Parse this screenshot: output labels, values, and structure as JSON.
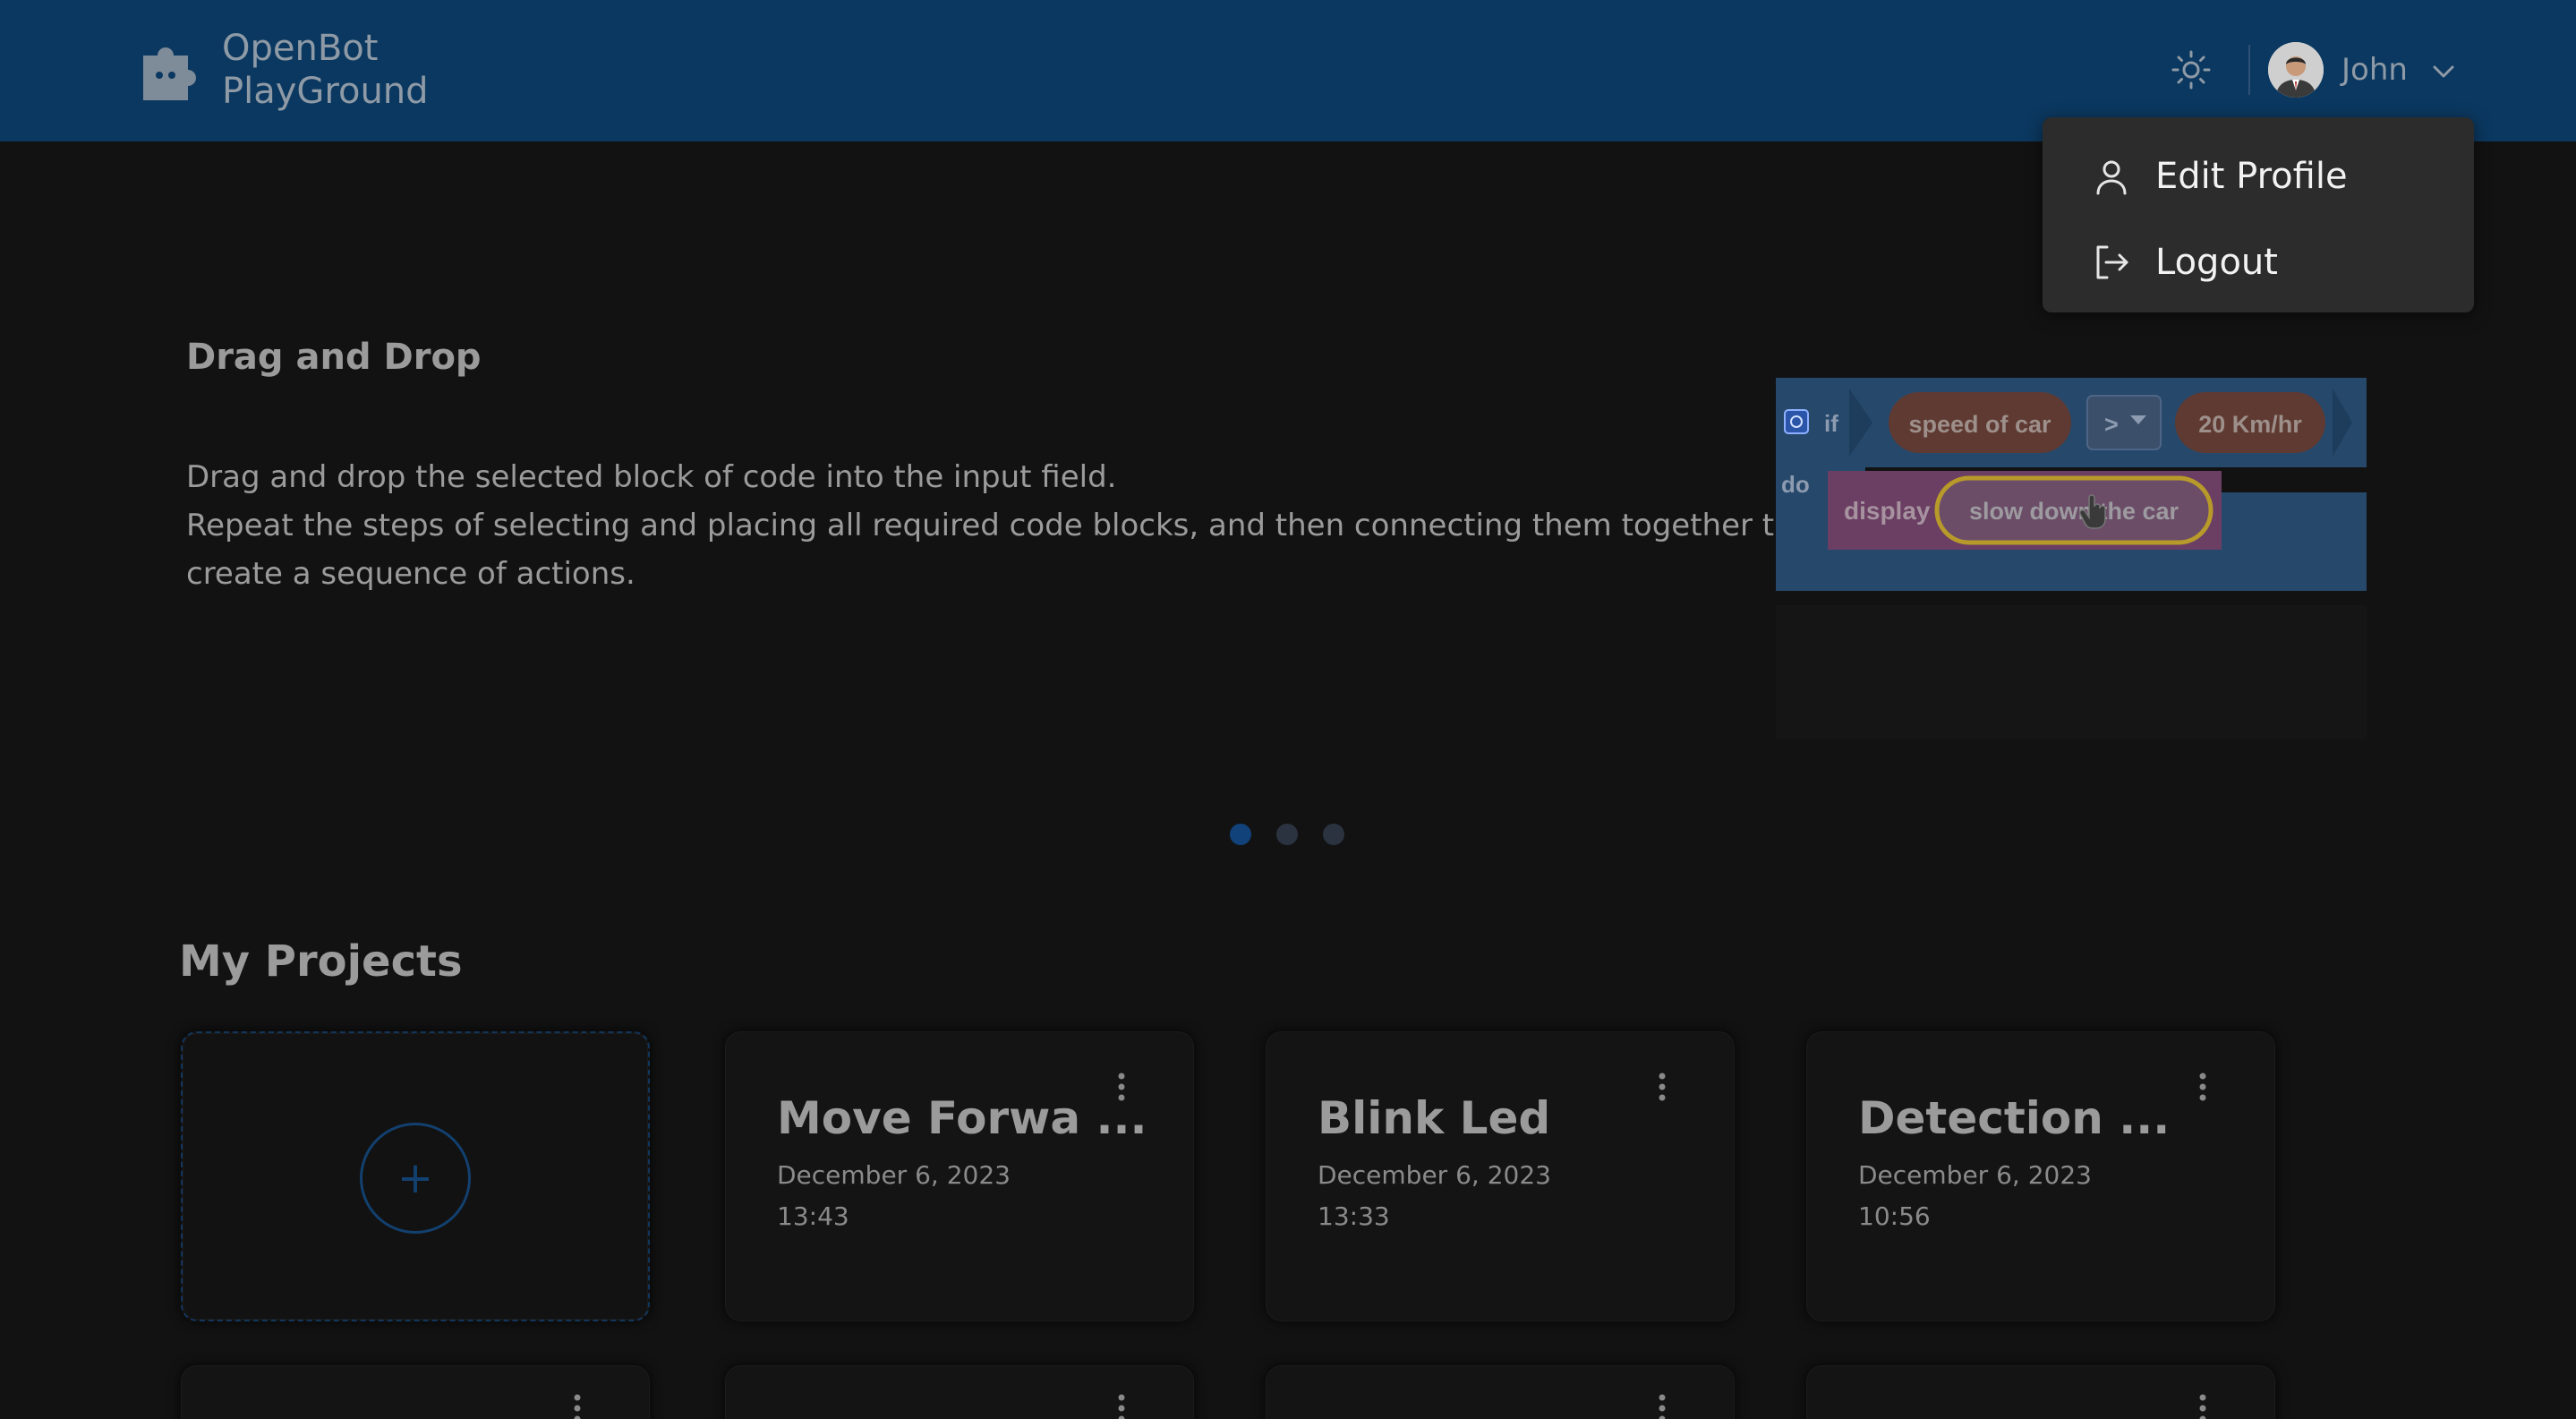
{
  "header": {
    "brand_line1": "OpenBot",
    "brand_line2": "PlayGround",
    "user_name": "John",
    "bg_color": "#0b3860"
  },
  "user_menu": {
    "items": [
      {
        "label": "Edit Profile",
        "icon": "user-icon"
      },
      {
        "label": "Logout",
        "icon": "logout-icon"
      }
    ]
  },
  "carousel": {
    "title": "Drag and Drop",
    "description_lines": [
      "Drag and drop the selected block of code into the input field.",
      "Repeat the steps of selecting and placing all required code blocks, and then connecting them together to",
      "create a sequence of actions."
    ],
    "block": {
      "if_label": "if",
      "do_label": "do",
      "condition_left": "speed of car",
      "operator": ">",
      "condition_right": "20 Km/hr",
      "action": "display",
      "action_text": "slow down the car"
    },
    "active_slide": 1,
    "total_slides": 3
  },
  "projects": {
    "title": "My Projects",
    "new_project_symbol": "+",
    "items": [
      {
        "name": "Move Forwa ...",
        "date": "December 6, 2023",
        "time": "13:43"
      },
      {
        "name": "Blink Led",
        "date": "December 6, 2023",
        "time": "13:33"
      },
      {
        "name": "Detection ...",
        "date": "December 6, 2023",
        "time": "10:56"
      }
    ]
  }
}
